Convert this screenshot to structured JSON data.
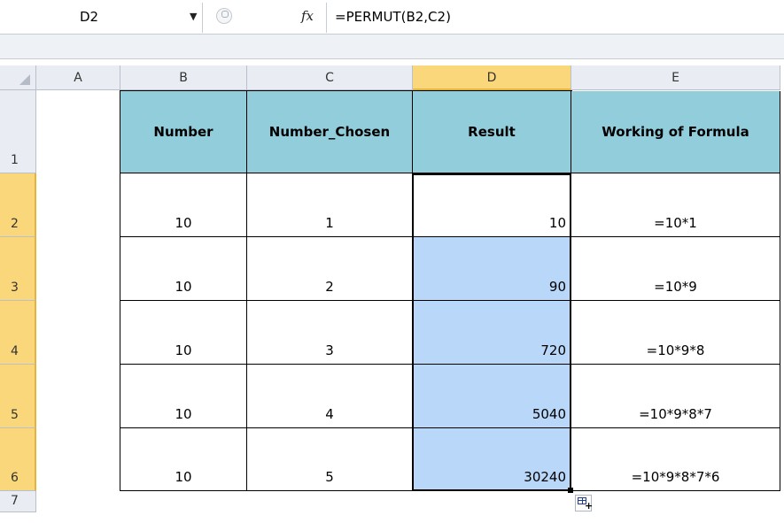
{
  "formula_bar": {
    "name_box": "D2",
    "fx_label": "fx",
    "formula": "=PERMUT(B2,C2)"
  },
  "columns": [
    "A",
    "B",
    "C",
    "D",
    "E"
  ],
  "rows": [
    "1",
    "2",
    "3",
    "4",
    "5",
    "6",
    "7"
  ],
  "table": {
    "headers": [
      "Number",
      "Number_Chosen",
      "Result",
      "Working of Formula"
    ],
    "rows": [
      {
        "number": "10",
        "chosen": "1",
        "result": "10",
        "working": "=10*1"
      },
      {
        "number": "10",
        "chosen": "2",
        "result": "90",
        "working": "=10*9"
      },
      {
        "number": "10",
        "chosen": "3",
        "result": "720",
        "working": "=10*9*8"
      },
      {
        "number": "10",
        "chosen": "4",
        "result": "5040",
        "working": "=10*9*8*7"
      },
      {
        "number": "10",
        "chosen": "5",
        "result": "30240",
        "working": "=10*9*8*7*6"
      }
    ]
  },
  "colors": {
    "header_fill": "#92cddc",
    "selection_fill": "#b8d7f9",
    "active_header": "#f9d77a"
  }
}
